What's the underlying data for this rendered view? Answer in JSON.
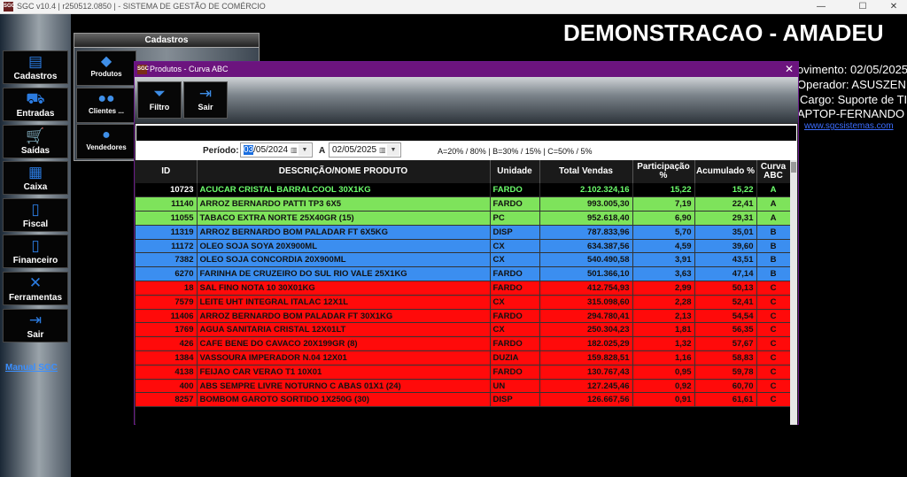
{
  "app": {
    "icon": "SGC",
    "title": "SGC v10.4 | r250512.0850 | - SISTEMA DE GESTÃO DE COMÉRCIO"
  },
  "window_controls": {
    "minimize": "—",
    "maximize": "☐",
    "close": "✕"
  },
  "sidebar": {
    "items": [
      {
        "label": "Cadastros",
        "icon": "database-icon",
        "glyph": "▤"
      },
      {
        "label": "Entradas",
        "icon": "truck-icon",
        "glyph": "⛟"
      },
      {
        "label": "Saídas",
        "icon": "cart-icon",
        "glyph": "🛒"
      },
      {
        "label": "Caixa",
        "icon": "register-icon",
        "glyph": "▦"
      },
      {
        "label": "Fiscal",
        "icon": "document-icon",
        "glyph": "▯"
      },
      {
        "label": "Financeiro",
        "icon": "finance-doc-icon",
        "glyph": "▯"
      },
      {
        "label": "Ferramentas",
        "icon": "tools-icon",
        "glyph": "✕"
      },
      {
        "label": "Sair",
        "icon": "exit-door-icon",
        "glyph": "⇥"
      }
    ],
    "manual_link": "Manual SGC"
  },
  "cadastros_panel": {
    "title": "Cadastros",
    "items": [
      {
        "label": "Produtos",
        "icon": "box-icon",
        "glyph": "◆"
      },
      {
        "label": "Clientes ...",
        "icon": "people-icon",
        "glyph": "●●"
      },
      {
        "label": "Vendedores",
        "icon": "salesperson-icon",
        "glyph": "●"
      }
    ]
  },
  "header": {
    "company": "DEMONSTRACAO - AMADEU",
    "movimento": "ovimento: 02/05/2025",
    "operador": "Operador: ASUSZEN",
    "cargo": "Cargo: Suporte de TI",
    "host": "APTOP-FERNANDO",
    "site": "www.sgcsistemas.com"
  },
  "dialog": {
    "icon": "SGC",
    "title": "Produtos - Curva ABC",
    "close": "✕",
    "toolbar": [
      {
        "label": "Filtro",
        "icon": "filter-icon",
        "glyph": "⏷"
      },
      {
        "label": "Sair",
        "icon": "exit-icon",
        "glyph": "⇥"
      }
    ],
    "period_label": "Período:",
    "date_from": {
      "selected": "03",
      "rest": "/05/2024"
    },
    "date_sep": "A",
    "date_to": "02/05/2025",
    "legend": "A=20% / 80% | B=30% / 15% | C=50% / 5%",
    "columns": [
      "ID",
      "DESCRIÇÃO/NOME PRODUTO",
      "Unidade",
      "Total Vendas",
      "Participação %",
      "Acumulado %",
      "Curva ABC"
    ],
    "rows": [
      {
        "id": "10723",
        "desc": "ACUCAR CRISTAL BARRALCOOL 30X1KG",
        "un": "FARDO",
        "total": "2.102.324,16",
        "part": "15,22",
        "acum": "15,22",
        "curva": "A",
        "selected": true
      },
      {
        "id": "11140",
        "desc": "ARROZ BERNARDO PATTI TP3 6X5",
        "un": "FARDO",
        "total": "993.005,30",
        "part": "7,19",
        "acum": "22,41",
        "curva": "A"
      },
      {
        "id": "11055",
        "desc": "TABACO EXTRA NORTE 25X40GR (15)",
        "un": "PC",
        "total": "952.618,40",
        "part": "6,90",
        "acum": "29,31",
        "curva": "A"
      },
      {
        "id": "11319",
        "desc": "ARROZ BERNARDO BOM PALADAR FT 6X5KG",
        "un": "DISP",
        "total": "787.833,96",
        "part": "5,70",
        "acum": "35,01",
        "curva": "B"
      },
      {
        "id": "11172",
        "desc": "OLEO SOJA SOYA 20X900ML",
        "un": "CX",
        "total": "634.387,56",
        "part": "4,59",
        "acum": "39,60",
        "curva": "B"
      },
      {
        "id": "7382",
        "desc": "OLEO SOJA CONCORDIA 20X900ML",
        "un": "CX",
        "total": "540.490,58",
        "part": "3,91",
        "acum": "43,51",
        "curva": "B"
      },
      {
        "id": "6270",
        "desc": "FARINHA DE CRUZEIRO DO SUL RIO VALE 25X1KG",
        "un": "FARDO",
        "total": "501.366,10",
        "part": "3,63",
        "acum": "47,14",
        "curva": "B"
      },
      {
        "id": "18",
        "desc": "SAL FINO NOTA 10 30X01KG",
        "un": "FARDO",
        "total": "412.754,93",
        "part": "2,99",
        "acum": "50,13",
        "curva": "C"
      },
      {
        "id": "7579",
        "desc": "LEITE UHT INTEGRAL ITALAC 12X1L",
        "un": "CX",
        "total": "315.098,60",
        "part": "2,28",
        "acum": "52,41",
        "curva": "C"
      },
      {
        "id": "11406",
        "desc": "ARROZ BERNARDO BOM PALADAR FT 30X1KG",
        "un": "FARDO",
        "total": "294.780,41",
        "part": "2,13",
        "acum": "54,54",
        "curva": "C"
      },
      {
        "id": "1769",
        "desc": "AGUA SANITARIA CRISTAL 12X01LT",
        "un": "CX",
        "total": "250.304,23",
        "part": "1,81",
        "acum": "56,35",
        "curva": "C"
      },
      {
        "id": "426",
        "desc": "CAFE BENE DO CAVACO 20X199GR (8)",
        "un": "FARDO",
        "total": "182.025,29",
        "part": "1,32",
        "acum": "57,67",
        "curva": "C"
      },
      {
        "id": "1384",
        "desc": "VASSOURA IMPERADOR N.04 12X01",
        "un": "DUZIA",
        "total": "159.828,51",
        "part": "1,16",
        "acum": "58,83",
        "curva": "C"
      },
      {
        "id": "4138",
        "desc": "FEIJAO CAR VERAO T1 10X01",
        "un": "FARDO",
        "total": "130.767,43",
        "part": "0,95",
        "acum": "59,78",
        "curva": "C"
      },
      {
        "id": "400",
        "desc": "ABS SEMPRE LIVRE NOTURNO C ABAS 01X1 (24)",
        "un": "UN",
        "total": "127.245,46",
        "part": "0,92",
        "acum": "60,70",
        "curva": "C"
      },
      {
        "id": "8257",
        "desc": "BOMBOM GAROTO SORTIDO 1X250G (30)",
        "un": "DISP",
        "total": "126.667,56",
        "part": "0,91",
        "acum": "61,61",
        "curva": "C"
      }
    ]
  }
}
